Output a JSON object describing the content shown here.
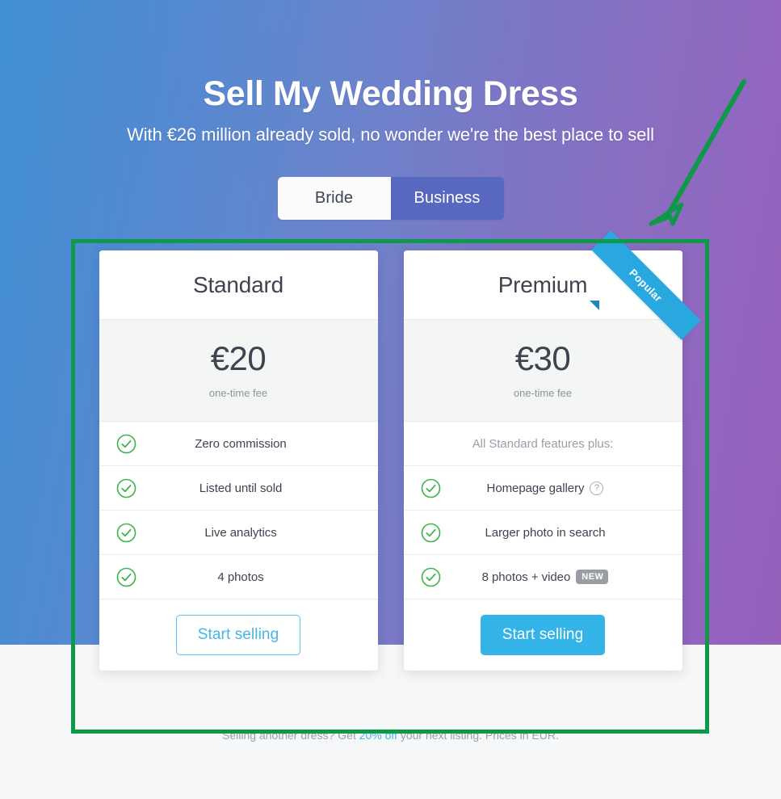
{
  "hero": {
    "title": "Sell My Wedding Dress",
    "subtitle": "With €26 million already sold, no wonder we're the best place to sell",
    "gradient_start": "#3a8ed6",
    "gradient_end": "#8e54b4"
  },
  "toggle": {
    "options": [
      {
        "label": "Bride",
        "selected": false
      },
      {
        "label": "Business",
        "selected": true
      }
    ],
    "active_color": "#5867c0"
  },
  "plans": [
    {
      "name": "Standard",
      "price": "€20",
      "price_note": "one-time fee",
      "ribbon": null,
      "subheading": null,
      "features": [
        {
          "label": "Zero commission",
          "icon": "check-circle-icon",
          "help": false,
          "badge": null
        },
        {
          "label": "Listed until sold",
          "icon": "check-circle-icon",
          "help": false,
          "badge": null
        },
        {
          "label": "Live analytics",
          "icon": "check-circle-icon",
          "help": false,
          "badge": null
        },
        {
          "label": "4 photos",
          "icon": "check-circle-icon",
          "help": false,
          "badge": null
        }
      ],
      "cta": {
        "label": "Start selling",
        "style": "outline"
      }
    },
    {
      "name": "Premium",
      "price": "€30",
      "price_note": "one-time fee",
      "ribbon": {
        "label": "Popular",
        "color": "#29a8df"
      },
      "subheading": "All Standard features plus:",
      "features": [
        {
          "label": "Homepage gallery",
          "icon": "check-circle-icon",
          "help": true,
          "help_glyph": "?",
          "badge": null
        },
        {
          "label": "Larger photo in search",
          "icon": "check-circle-icon",
          "help": false,
          "badge": null
        },
        {
          "label": "8 photos + video",
          "icon": "check-circle-icon",
          "help": false,
          "badge": "NEW"
        }
      ],
      "cta": {
        "label": "Start selling",
        "style": "solid"
      }
    }
  ],
  "footer": {
    "text_before": "Selling another dress? Get ",
    "link_text": "20% off",
    "text_after": " your next listing. Prices in EUR."
  },
  "annotation": {
    "color": "#0d9949",
    "type": "highlight-rect-with-arrow",
    "target": "pricing-cards-region"
  },
  "check_color": "#3cb44a"
}
